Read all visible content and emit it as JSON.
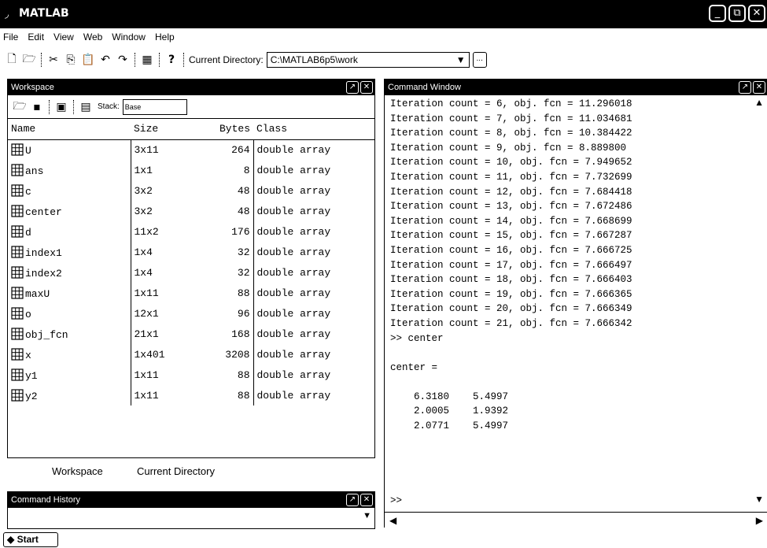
{
  "window": {
    "title": "MATLAB",
    "controls": [
      "_",
      "⧉",
      "✕"
    ]
  },
  "menu": [
    {
      "label": "File"
    },
    {
      "label": "Edit"
    },
    {
      "label": "View"
    },
    {
      "label": "Web"
    },
    {
      "label": "Window"
    },
    {
      "label": "Help"
    }
  ],
  "toolbar": {
    "current_directory_label": "Current Directory:",
    "current_directory_value": "C:\\MATLAB6p5\\work",
    "browse_label": "..."
  },
  "workspace": {
    "title": "Workspace",
    "stack_label": "Stack:",
    "stack_value": "Base",
    "columns": {
      "name": "Name",
      "size": "Size",
      "bytes": "Bytes",
      "class": "Class"
    },
    "rows": [
      {
        "name": "U",
        "size": "3x11",
        "bytes": "264",
        "class": "double array"
      },
      {
        "name": "ans",
        "size": "1x1",
        "bytes": "8",
        "class": "double array"
      },
      {
        "name": "c",
        "size": "3x2",
        "bytes": "48",
        "class": "double array"
      },
      {
        "name": "center",
        "size": "3x2",
        "bytes": "48",
        "class": "double array"
      },
      {
        "name": "d",
        "size": "11x2",
        "bytes": "176",
        "class": "double array"
      },
      {
        "name": "index1",
        "size": "1x4",
        "bytes": "32",
        "class": "double array"
      },
      {
        "name": "index2",
        "size": "1x4",
        "bytes": "32",
        "class": "double array"
      },
      {
        "name": "maxU",
        "size": "1x11",
        "bytes": "88",
        "class": "double array"
      },
      {
        "name": "o",
        "size": "12x1",
        "bytes": "96",
        "class": "double array"
      },
      {
        "name": "obj_fcn",
        "size": "21x1",
        "bytes": "168",
        "class": "double array"
      },
      {
        "name": "x",
        "size": "1x401",
        "bytes": "3208",
        "class": "double array"
      },
      {
        "name": "y1",
        "size": "1x11",
        "bytes": "88",
        "class": "double array"
      },
      {
        "name": "y2",
        "size": "1x11",
        "bytes": "88",
        "class": "double array"
      }
    ],
    "tabs": {
      "workspace": "Workspace",
      "current_directory": "Current Directory"
    }
  },
  "command_history": {
    "title": "Command History"
  },
  "command_window": {
    "title": "Command Window",
    "lines": [
      "Iteration count = 6, obj. fcn = 11.296018",
      "Iteration count = 7, obj. fcn = 11.034681",
      "Iteration count = 8, obj. fcn = 10.384422",
      "Iteration count = 9, obj. fcn = 8.889800",
      "Iteration count = 10, obj. fcn = 7.949652",
      "Iteration count = 11, obj. fcn = 7.732699",
      "Iteration count = 12, obj. fcn = 7.684418",
      "Iteration count = 13, obj. fcn = 7.672486",
      "Iteration count = 14, obj. fcn = 7.668699",
      "Iteration count = 15, obj. fcn = 7.667287",
      "Iteration count = 16, obj. fcn = 7.666725",
      "Iteration count = 17, obj. fcn = 7.666497",
      "Iteration count = 18, obj. fcn = 7.666403",
      "Iteration count = 19, obj. fcn = 7.666365",
      "Iteration count = 20, obj. fcn = 7.666349",
      "Iteration count = 21, obj. fcn = 7.666342",
      ">> center",
      "",
      "center =",
      "",
      "    6.3180    5.4997",
      "    2.0005    1.9392",
      "    2.0771    5.4997"
    ],
    "prompt": ">>"
  },
  "start": {
    "label": "Start"
  }
}
